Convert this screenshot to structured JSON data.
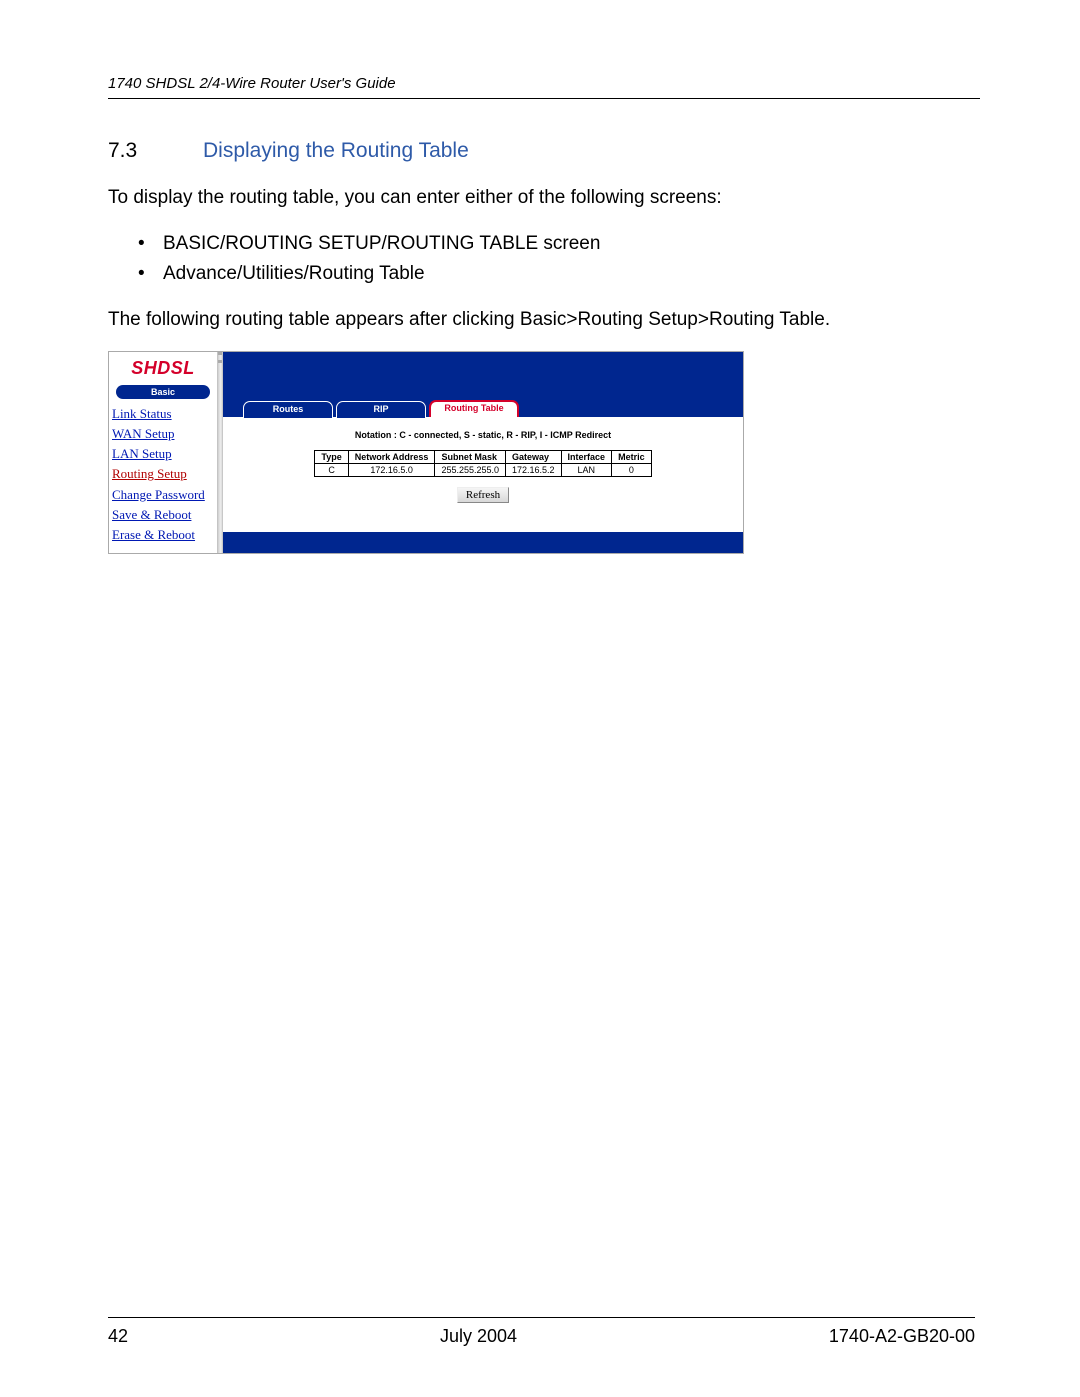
{
  "header": {
    "title": "1740 SHDSL 2/4-Wire Router User's Guide"
  },
  "section": {
    "number": "7.3",
    "title": "Displaying the Routing Table"
  },
  "para1": "To display the routing table, you can enter either of the following screens:",
  "bullets": [
    "BASIC/ROUTING SETUP/ROUTING TABLE screen",
    "Advance/Utilities/Routing Table"
  ],
  "para2": "The following routing table appears after clicking Basic>Routing Setup>Routing Table.",
  "screenshot": {
    "logo": "SHDSL",
    "basic_pill": "Basic",
    "sidebar": [
      "Link Status",
      "WAN Setup",
      "LAN Setup",
      "Routing Setup",
      "Change Password",
      "Save & Reboot",
      "Erase & Reboot"
    ],
    "sidebar_active_index": 3,
    "tabs": [
      "Routes",
      "RIP",
      "Routing Table"
    ],
    "active_tab_index": 2,
    "notation": "Notation : C - connected, S - static, R - RIP, I - ICMP Redirect",
    "table": {
      "headers": [
        "Type",
        "Network Address",
        "Subnet Mask",
        "Gateway",
        "Interface",
        "Metric"
      ],
      "rows": [
        [
          "C",
          "172.16.5.0",
          "255.255.255.0",
          "172.16.5.2",
          "LAN",
          "0"
        ]
      ]
    },
    "refresh": "Refresh"
  },
  "footer": {
    "page": "42",
    "date": "July 2004",
    "doc": "1740-A2-GB20-00"
  }
}
